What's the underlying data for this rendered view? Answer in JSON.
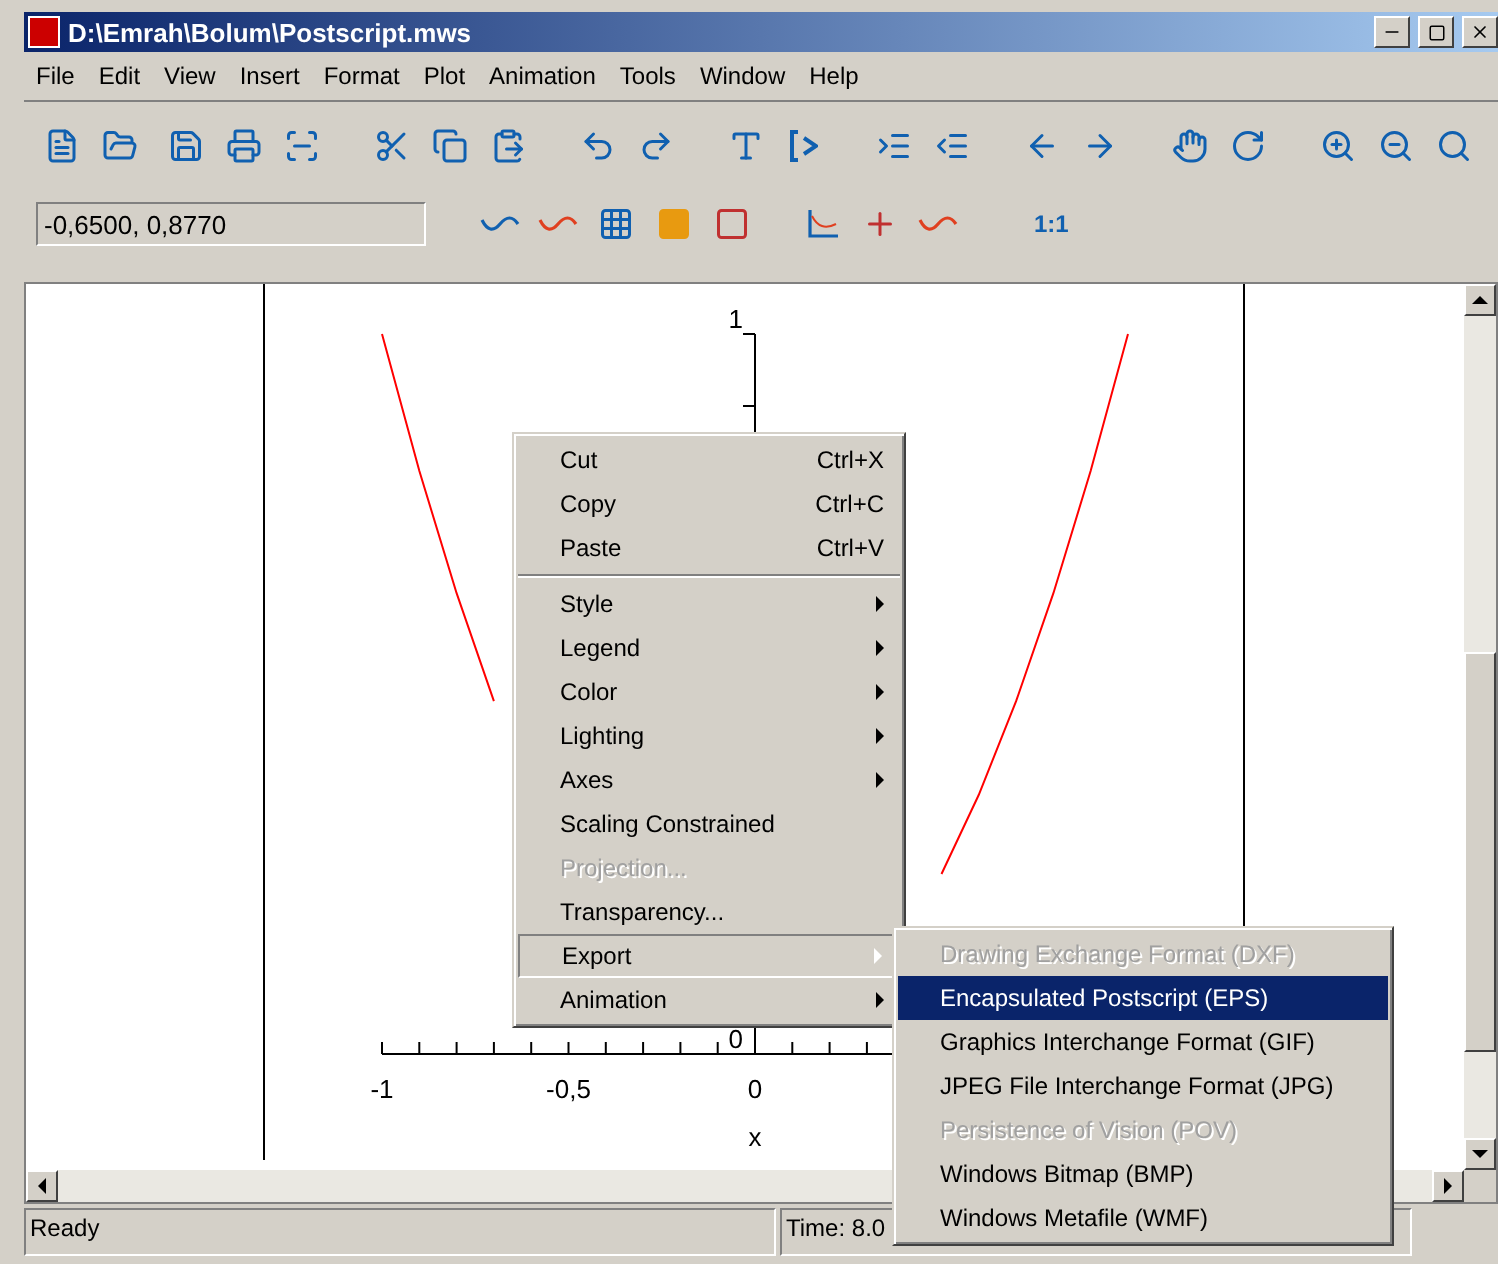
{
  "window": {
    "title": "D:\\Emrah\\Bolum\\Postscript.mws"
  },
  "menu_bar": [
    "File",
    "Edit",
    "View",
    "Insert",
    "Format",
    "Plot",
    "Animation",
    "Tools",
    "Window",
    "Help"
  ],
  "plot_toolbar": {
    "coordinates": "-0,6500, 0,8770",
    "aspect_button": "1:1"
  },
  "plot": {
    "chart_data": {
      "type": "line",
      "xlabel": "x",
      "x": [
        -1,
        -0.9,
        -0.8,
        -0.7,
        -0.6,
        -0.5,
        -0.4,
        -0.3,
        -0.2,
        -0.1,
        0,
        0.1,
        0.2,
        0.3,
        0.4,
        0.5,
        0.6,
        0.7,
        0.8,
        0.9,
        1
      ],
      "series": [
        {
          "color": "#ff0000",
          "values": [
            1,
            0.81,
            0.64,
            0.49,
            null,
            null,
            null,
            null,
            null,
            null,
            null,
            null,
            null,
            null,
            null,
            0.25,
            0.36,
            0.49,
            0.64,
            0.81,
            1
          ]
        }
      ],
      "xlim": [
        -1,
        1
      ],
      "ylim": [
        0,
        1
      ],
      "xticks": [
        {
          "value": -1,
          "label": "-1"
        },
        {
          "value": -0.5,
          "label": "-0,5"
        },
        {
          "value": 0,
          "label": "0"
        }
      ],
      "yticks": [
        {
          "value": 0,
          "label": "0"
        },
        {
          "value": 1,
          "label": "1"
        }
      ]
    }
  },
  "context_menu": [
    {
      "label": "Cut",
      "shortcut": "Ctrl+X",
      "submenu": false,
      "disabled": false,
      "selected": false
    },
    {
      "label": "Copy",
      "shortcut": "Ctrl+C",
      "submenu": false,
      "disabled": false,
      "selected": false
    },
    {
      "label": "Paste",
      "shortcut": "Ctrl+V",
      "submenu": false,
      "disabled": false,
      "selected": false,
      "separator_after": true
    },
    {
      "label": "Style",
      "submenu": true,
      "disabled": false,
      "selected": false
    },
    {
      "label": "Legend",
      "submenu": true,
      "disabled": false,
      "selected": false
    },
    {
      "label": "Color",
      "submenu": true,
      "disabled": false,
      "selected": false
    },
    {
      "label": "Lighting",
      "submenu": true,
      "disabled": false,
      "selected": false
    },
    {
      "label": "Axes",
      "submenu": true,
      "disabled": false,
      "selected": false
    },
    {
      "label": "Scaling Constrained",
      "submenu": false,
      "disabled": false,
      "selected": false
    },
    {
      "label": "Projection...",
      "submenu": false,
      "disabled": true,
      "selected": false
    },
    {
      "label": "Transparency...",
      "submenu": false,
      "disabled": false,
      "selected": false
    },
    {
      "label": "Export",
      "submenu": true,
      "disabled": false,
      "selected": true
    },
    {
      "label": "Animation",
      "submenu": true,
      "disabled": false,
      "selected": false
    }
  ],
  "export_submenu": [
    {
      "label": "Drawing Exchange Format (DXF)",
      "disabled": true,
      "selected": false
    },
    {
      "label": "Encapsulated Postscript (EPS)",
      "disabled": false,
      "selected": true
    },
    {
      "label": "Graphics Interchange Format (GIF)",
      "disabled": false,
      "selected": false
    },
    {
      "label": "JPEG File Interchange Format (JPG)",
      "disabled": false,
      "selected": false
    },
    {
      "label": "Persistence of Vision (POV)",
      "disabled": true,
      "selected": false
    },
    {
      "label": "Windows Bitmap (BMP)",
      "disabled": false,
      "selected": false
    },
    {
      "label": "Windows Metafile (WMF)",
      "disabled": false,
      "selected": false
    }
  ],
  "status_bar": {
    "message": "Ready",
    "time": "Time: 8.0"
  }
}
